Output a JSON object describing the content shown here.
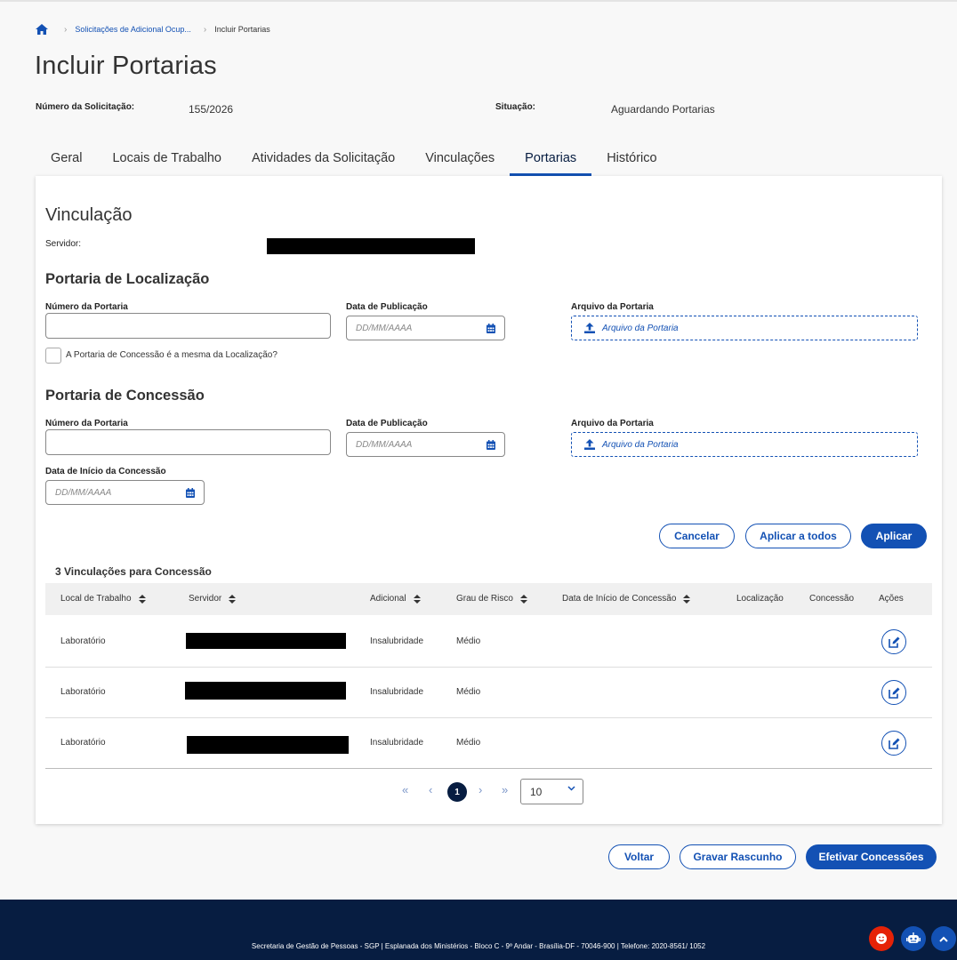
{
  "breadcrumb": {
    "home_icon": "home-icon",
    "items": [
      "Solicitações de Adicional Ocup...",
      "Incluir Portarias"
    ]
  },
  "page_title": "Incluir Portarias",
  "info": {
    "numero_label": "Número da Solicitação:",
    "numero_value": "155/2026",
    "situacao_label": "Situação:",
    "situacao_value": "Aguardando Portarias"
  },
  "tabs": [
    {
      "label": "Geral"
    },
    {
      "label": "Locais de Trabalho"
    },
    {
      "label": "Atividades da Solicitação"
    },
    {
      "label": "Vinculações"
    },
    {
      "label": "Portarias",
      "active": true
    },
    {
      "label": "Histórico"
    }
  ],
  "vinculacao": {
    "title": "Vinculação",
    "servidor_label": "Servidor:"
  },
  "localizacao": {
    "title": "Portaria de Localização",
    "numero_label": "Número da Portaria",
    "data_label": "Data de Publicação",
    "data_placeholder": "DD/MM/AAAA",
    "arquivo_label": "Arquivo da Portaria",
    "arquivo_placeholder": "Arquivo da Portaria",
    "checkbox_label": "A Portaria de Concessão é a mesma da Localização?"
  },
  "concessao": {
    "title": "Portaria de Concessão",
    "numero_label": "Número da Portaria",
    "data_label": "Data de Publicação",
    "data_placeholder": "DD/MM/AAAA",
    "arquivo_label": "Arquivo da Portaria",
    "arquivo_placeholder": "Arquivo da Portaria",
    "inicio_label": "Data de Início da Concessão",
    "inicio_placeholder": "DD/MM/AAAA"
  },
  "actions": {
    "cancelar": "Cancelar",
    "aplicar_todos": "Aplicar a todos",
    "aplicar": "Aplicar"
  },
  "table": {
    "caption": "3 Vinculações para Concessão",
    "headers": [
      "Local de Trabalho",
      "Servidor",
      "Adicional",
      "Grau de Risco",
      "Data de Início de Concessão",
      "Localização",
      "Concessão",
      "Ações"
    ],
    "rows": [
      {
        "local": "Laboratório",
        "adicional": "Insalubridade",
        "grau": "Médio"
      },
      {
        "local": "Laboratório",
        "adicional": "Insalubridade",
        "grau": "Médio"
      },
      {
        "local": "Laboratório",
        "adicional": "Insalubridade",
        "grau": "Médio"
      }
    ]
  },
  "pagination": {
    "current_page": "1",
    "page_size": "10"
  },
  "bottom_actions": {
    "voltar": "Voltar",
    "gravar": "Gravar Rascunho",
    "efetivar": "Efetivar Concessões"
  },
  "footer": {
    "text": "Secretaria de Gestão de Pessoas - SGP | Esplanada dos Ministérios - Bloco C - 9º Andar - Brasília-DF - 70046-900 | Telefone: 2020-8561/ 1052"
  },
  "colors": {
    "primary": "#1351b4",
    "dark_blue": "#071d41",
    "footer_bg": "#071d41",
    "fab_red": "#e52207"
  }
}
